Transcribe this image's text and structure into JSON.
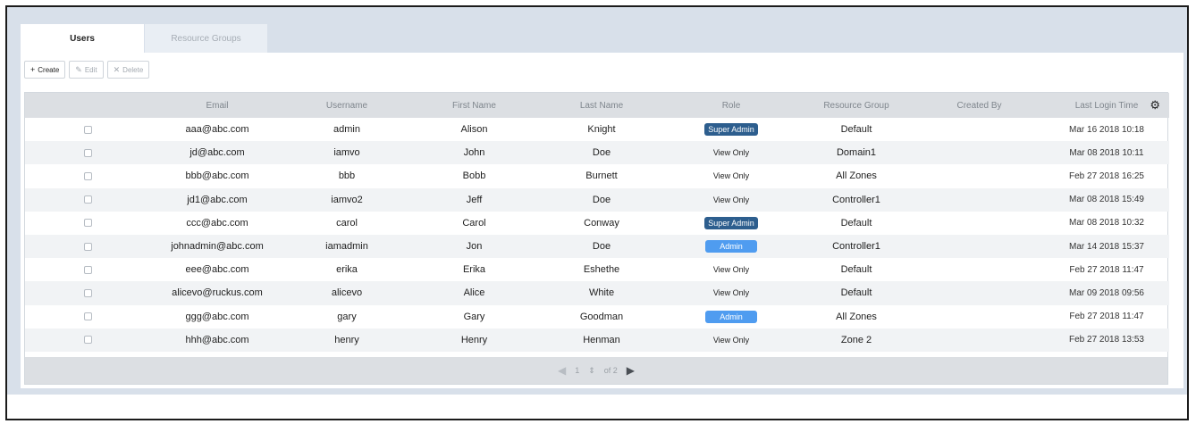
{
  "colors": {
    "role_super_admin": "#2d5e8e",
    "role_admin": "#4f9cf0",
    "header_bg": "#dcdfe3",
    "page_band": "#d8e0ea"
  },
  "tabs": [
    {
      "label": "Users",
      "active": true
    },
    {
      "label": "Resource Groups",
      "active": false
    }
  ],
  "toolbar": {
    "create_icon": "plus-icon",
    "create_label": "Create",
    "edit_icon": "pencil-icon",
    "edit_label": "Edit",
    "delete_icon": "x-icon",
    "delete_label": "Delete"
  },
  "table": {
    "columns": [
      "Email",
      "Username",
      "First Name",
      "Last Name",
      "Role",
      "Resource Group",
      "Created By",
      "Last Login Time"
    ],
    "settings_icon": "gear-icon",
    "rows": [
      {
        "email": "aaa@abc.com",
        "username": "admin",
        "first": "Alison",
        "last": "Knight",
        "role": "Super Admin",
        "group": "Default",
        "created_by": "",
        "login": "Mar 16 2018 10:18"
      },
      {
        "email": "jd@abc.com",
        "username": "iamvo",
        "first": "John",
        "last": "Doe",
        "role": "View Only",
        "group": "Domain1",
        "created_by": "",
        "login": "Mar 08 2018 10:11"
      },
      {
        "email": "bbb@abc.com",
        "username": "bbb",
        "first": "Bobb",
        "last": "Burnett",
        "role": "View Only",
        "group": "All Zones",
        "created_by": "",
        "login": "Feb 27 2018 16:25"
      },
      {
        "email": "jd1@abc.com",
        "username": "iamvo2",
        "first": "Jeff",
        "last": "Doe",
        "role": "View Only",
        "group": "Controller1",
        "created_by": "",
        "login": "Mar 08 2018 15:49"
      },
      {
        "email": "ccc@abc.com",
        "username": "carol",
        "first": "Carol",
        "last": "Conway",
        "role": "Super Admin",
        "group": "Default",
        "created_by": "",
        "login": "Mar 08 2018 10:32"
      },
      {
        "email": "johnadmin@abc.com",
        "username": "iamadmin",
        "first": "Jon",
        "last": "Doe",
        "role": "Admin",
        "group": "Controller1",
        "created_by": "",
        "login": "Mar 14 2018 15:37"
      },
      {
        "email": "eee@abc.com",
        "username": "erika",
        "first": "Erika",
        "last": "Eshethe",
        "role": "View Only",
        "group": "Default",
        "created_by": "",
        "login": "Feb 27 2018 11:47"
      },
      {
        "email": "alicevo@ruckus.com",
        "username": "alicevo",
        "first": "Alice",
        "last": "White",
        "role": "View Only",
        "group": "Default",
        "created_by": "",
        "login": "Mar 09 2018 09:56"
      },
      {
        "email": "ggg@abc.com",
        "username": "gary",
        "first": "Gary",
        "last": "Goodman",
        "role": "Admin",
        "group": "All Zones",
        "created_by": "",
        "login": "Feb 27 2018 11:47"
      },
      {
        "email": "hhh@abc.com",
        "username": "henry",
        "first": "Henry",
        "last": "Henman",
        "role": "View Only",
        "group": "Zone 2",
        "created_by": "",
        "login": "Feb 27 2018 13:53"
      }
    ]
  },
  "pagination": {
    "current_page": "1",
    "of_label": "of 2",
    "prev_icon": "caret-left-icon",
    "next_icon": "caret-right-icon",
    "stepper_icon": "stepper-icon"
  }
}
